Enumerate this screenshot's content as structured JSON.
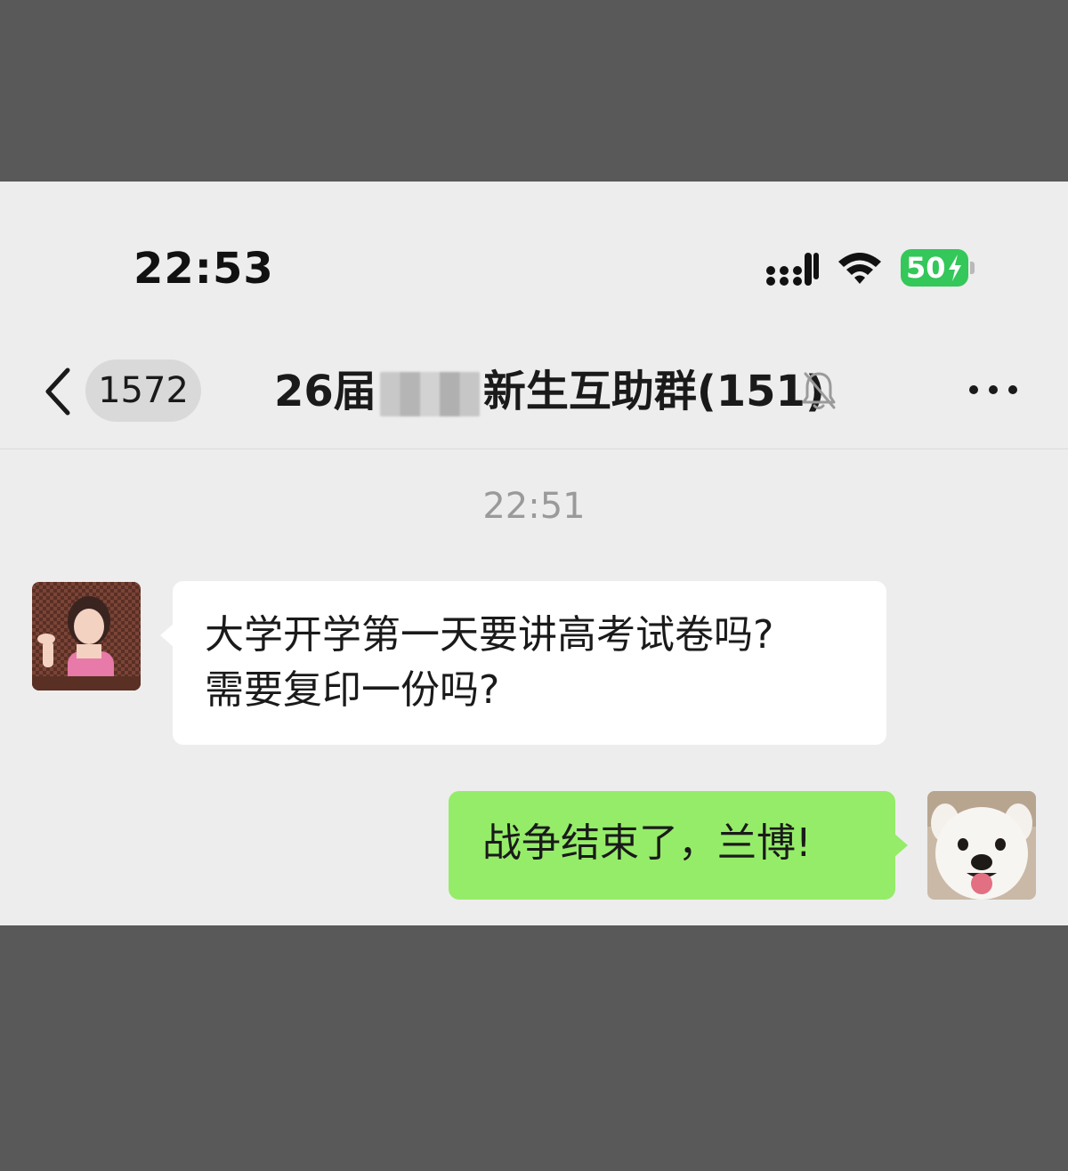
{
  "status_bar": {
    "time": "22:53",
    "battery_level": "50",
    "charging": true
  },
  "nav_bar": {
    "unread_count": "1572",
    "title_prefix": "26届",
    "title_suffix": "新生互助群(151)",
    "muted": true
  },
  "messages": {
    "timestamp": "22:51",
    "incoming": {
      "line1": "大学开学第一天要讲高考试卷吗?",
      "line2": "需要复印一份吗?"
    },
    "outgoing": {
      "text": "战争结束了，兰博!"
    }
  },
  "colors": {
    "outgoing_bubble": "#95ec69",
    "incoming_bubble": "#ffffff",
    "battery": "#34c759",
    "chat_background": "#ededed"
  },
  "icons": [
    "back-icon",
    "signal-icon",
    "wifi-icon",
    "battery-icon",
    "bell-muted-icon",
    "more-icon"
  ]
}
